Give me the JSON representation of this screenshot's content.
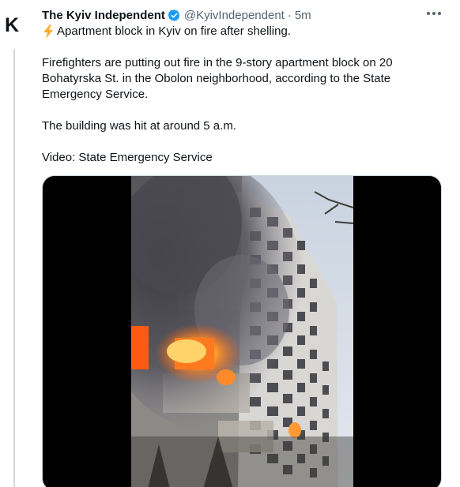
{
  "account": {
    "avatar_letter": "K",
    "display_name": "The Kyiv Independent",
    "handle": "@KyivIndependent",
    "separator": "·",
    "time": "5m",
    "verified_color": "#1d9bf0"
  },
  "tweet": {
    "line1": "Apartment block in Kyiv on fire after shelling.",
    "line1_emoji_icon": "lightning-bolt-icon",
    "paragraph2_line1": "Firefighters are putting out fire in the 9-story apartment block on 20",
    "paragraph2_line2": "Bohatyrska St. in the Obolon neighborhood, according to the State",
    "paragraph2_line3": "Emergency Service.",
    "paragraph3": "The building was hit at around 5 a.m.",
    "paragraph4": "Video: State Emergency Service"
  },
  "media": {
    "type": "video",
    "subject": "burning apartment building",
    "fire_color": "#ff6a1a"
  },
  "colors": {
    "text": "#0f1419",
    "secondary": "#536471",
    "border": "#cfd9de"
  }
}
